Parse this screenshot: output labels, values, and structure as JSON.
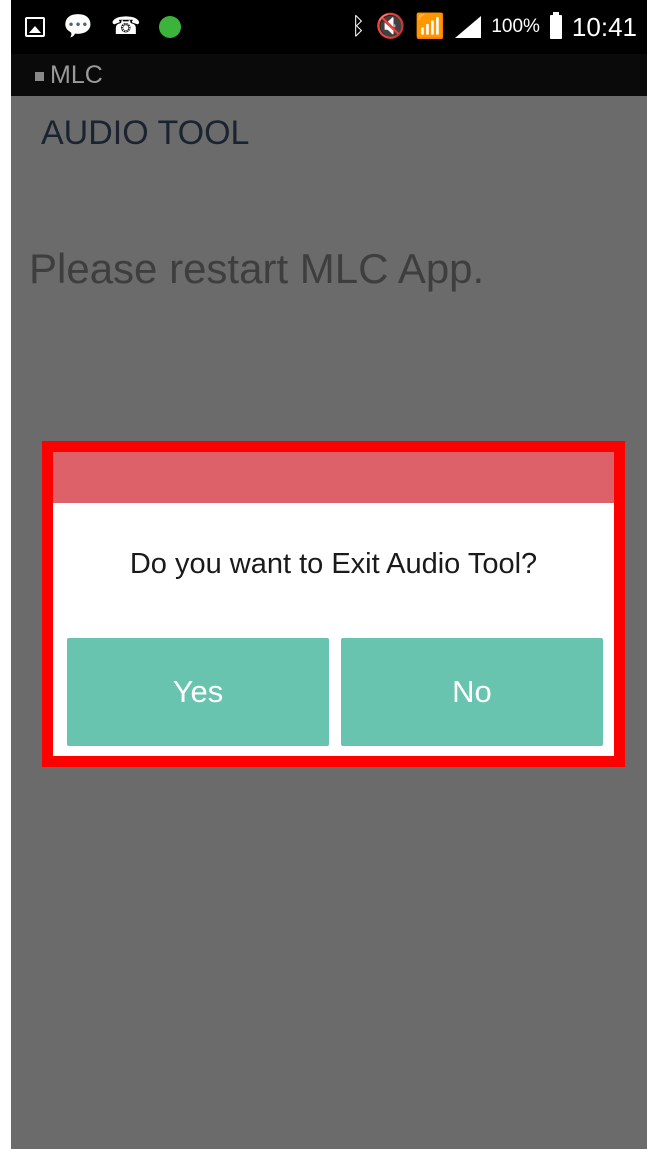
{
  "status_bar": {
    "left_icons": [
      "gallery-icon",
      "chat-icon",
      "missed-call-icon",
      "green-dot-icon"
    ],
    "right_icons": [
      "bluetooth-icon",
      "mute-icon",
      "wifi-icon",
      "signal-icon",
      "battery-icon"
    ],
    "battery_percent": "100%",
    "time": "10:41"
  },
  "app_bar": {
    "title": "MLC"
  },
  "page": {
    "title": "AUDIO TOOL",
    "message": "Please restart MLC App."
  },
  "dialog": {
    "message": "Do you want to Exit Audio Tool?",
    "yes_label": "Yes",
    "no_label": "No",
    "header_color": "#dd6169",
    "button_color": "#68c4ae",
    "highlight_color": "#ff0000"
  }
}
